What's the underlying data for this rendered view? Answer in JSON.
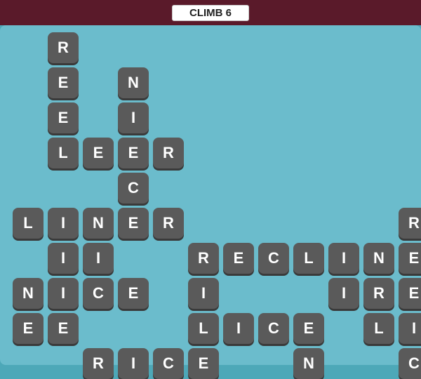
{
  "header": {
    "title": "CLIMB 6",
    "bg_color": "#5a1a2a",
    "title_bg": "#ffffff"
  },
  "board": {
    "bg_color": "#6bbccc",
    "tile_color": "#5a5a5a",
    "tile_shadow": "#3a3a3a",
    "tile_text_color": "#ffffff"
  },
  "tiles": [
    {
      "letter": "R",
      "col": 1,
      "row": 1
    },
    {
      "letter": "E",
      "col": 1,
      "row": 2
    },
    {
      "letter": "E",
      "col": 1,
      "row": 3
    },
    {
      "letter": "N",
      "col": 3,
      "row": 2
    },
    {
      "letter": "I",
      "col": 3,
      "row": 3
    },
    {
      "letter": "L",
      "col": 1,
      "row": 4
    },
    {
      "letter": "E",
      "col": 2,
      "row": 4
    },
    {
      "letter": "E",
      "col": 3,
      "row": 4
    },
    {
      "letter": "R",
      "col": 4,
      "row": 4
    },
    {
      "letter": "C",
      "col": 3,
      "row": 5
    },
    {
      "letter": "L",
      "col": 0,
      "row": 6
    },
    {
      "letter": "I",
      "col": 1,
      "row": 6
    },
    {
      "letter": "N",
      "col": 2,
      "row": 6
    },
    {
      "letter": "E",
      "col": 3,
      "row": 6
    },
    {
      "letter": "R",
      "col": 4,
      "row": 6
    },
    {
      "letter": "R",
      "col": 11,
      "row": 6
    },
    {
      "letter": "I",
      "col": 1,
      "row": 7
    },
    {
      "letter": "I",
      "col": 2,
      "row": 7
    },
    {
      "letter": "R",
      "col": 5,
      "row": 7
    },
    {
      "letter": "E",
      "col": 6,
      "row": 7
    },
    {
      "letter": "C",
      "col": 7,
      "row": 7
    },
    {
      "letter": "L",
      "col": 8,
      "row": 7
    },
    {
      "letter": "I",
      "col": 9,
      "row": 7
    },
    {
      "letter": "N",
      "col": 10,
      "row": 7
    },
    {
      "letter": "E",
      "col": 11,
      "row": 7
    },
    {
      "letter": "N",
      "col": 0,
      "row": 8
    },
    {
      "letter": "I",
      "col": 1,
      "row": 8
    },
    {
      "letter": "C",
      "col": 2,
      "row": 8
    },
    {
      "letter": "E",
      "col": 3,
      "row": 8
    },
    {
      "letter": "I",
      "col": 5,
      "row": 8
    },
    {
      "letter": "I",
      "col": 9,
      "row": 8
    },
    {
      "letter": "R",
      "col": 10,
      "row": 8
    },
    {
      "letter": "E",
      "col": 11,
      "row": 8
    },
    {
      "letter": "L",
      "col": 10,
      "row": 8
    },
    {
      "letter": "E",
      "col": 0,
      "row": 9
    },
    {
      "letter": "E",
      "col": 1,
      "row": 9
    },
    {
      "letter": "L",
      "col": 5,
      "row": 9
    },
    {
      "letter": "I",
      "col": 6,
      "row": 9
    },
    {
      "letter": "C",
      "col": 7,
      "row": 9
    },
    {
      "letter": "E",
      "col": 8,
      "row": 9
    },
    {
      "letter": "L",
      "col": 11,
      "row": 9
    },
    {
      "letter": "I",
      "col": 11,
      "row": 9
    },
    {
      "letter": "R",
      "col": 2,
      "row": 10
    },
    {
      "letter": "I",
      "col": 3,
      "row": 10
    },
    {
      "letter": "C",
      "col": 4,
      "row": 10
    },
    {
      "letter": "E",
      "col": 5,
      "row": 10
    },
    {
      "letter": "N",
      "col": 8,
      "row": 10
    },
    {
      "letter": "C",
      "col": 11,
      "row": 10
    }
  ]
}
